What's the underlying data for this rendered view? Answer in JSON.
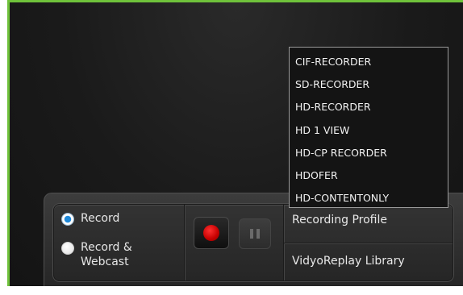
{
  "colors": {
    "accent_border": "#6fc23b",
    "record_red": "#c50000",
    "radio_selected": "#1e88d8"
  },
  "record_mode": {
    "options": [
      {
        "label": "Record",
        "selected": true
      },
      {
        "label": "Record & Webcast",
        "selected": false
      }
    ]
  },
  "controls": {
    "record_icon": "record-icon",
    "pause_icon": "pause-icon"
  },
  "menu": {
    "recording_profile_label": "Recording Profile",
    "library_label": "VidyoReplay Library"
  },
  "profile_dropdown": {
    "items": [
      "CIF-RECORDER",
      "SD-RECORDER",
      "HD-RECORDER",
      "HD 1 VIEW",
      "HD-CP RECORDER",
      "HDOFER",
      "HD-CONTENTONLY"
    ]
  }
}
